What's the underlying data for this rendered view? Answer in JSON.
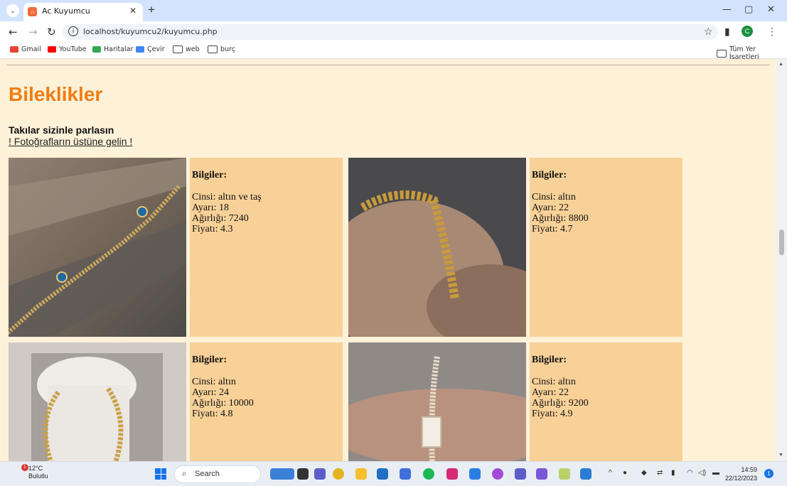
{
  "browser": {
    "tab_title": "Ac Kuyumcu",
    "url": "localhost/kuyumcu2/kuyumcu.php",
    "bookmarks": [
      "Gmail",
      "YouTube",
      "Haritalar",
      "Çevir",
      "web",
      "burç"
    ],
    "all_bookmarks": "Tüm Yer İşaretleri",
    "profile_initial": "C"
  },
  "page": {
    "heading": "Bileklikler",
    "subtitle": "Takılar sizinle parlasın",
    "hint_link": "! Fotoğrafların üstüne gelin !",
    "products": [
      {
        "info_title": "Bilgiler:",
        "cinsi": "Cinsi: altın ve taş",
        "ayari": "Ayarı: 18",
        "agirligi": "Ağırlığı: 7240",
        "fiyati": "Fiyatı: 4.3",
        "image": "bracelet-evil-eye-photo"
      },
      {
        "info_title": "Bilgiler:",
        "cinsi": "Cinsi: altın",
        "ayari": "Ayarı: 22",
        "agirligi": "Ağırlığı: 8800",
        "fiyati": "Fiyatı: 4.7",
        "image": "bracelet-rope-photo"
      },
      {
        "info_title": "Bilgiler:",
        "cinsi": "Cinsi: altın",
        "ayari": "Ayarı: 24",
        "agirligi": "Ağırlığı: 10000",
        "fiyati": "Fiyatı: 4.8",
        "image": "bracelet-ball-chain-photo"
      },
      {
        "info_title": "Bilgiler:",
        "cinsi": "Cinsi: altın",
        "ayari": "Ayarı: 22",
        "agirligi": "Ağırlığı: 9200",
        "fiyati": "Fiyatı: 4.9",
        "image": "bracelet-stone-photo"
      }
    ]
  },
  "taskbar": {
    "temperature": "12°C",
    "weather": "Bulutlu",
    "weather_badge": "1",
    "search_placeholder": "Search",
    "time": "14:59",
    "date": "22/12/2023",
    "notification_count": "1"
  },
  "colors": {
    "page_bg": "#fdf1d8",
    "heading": "#f07d12",
    "info_bg": "#f8d198"
  }
}
